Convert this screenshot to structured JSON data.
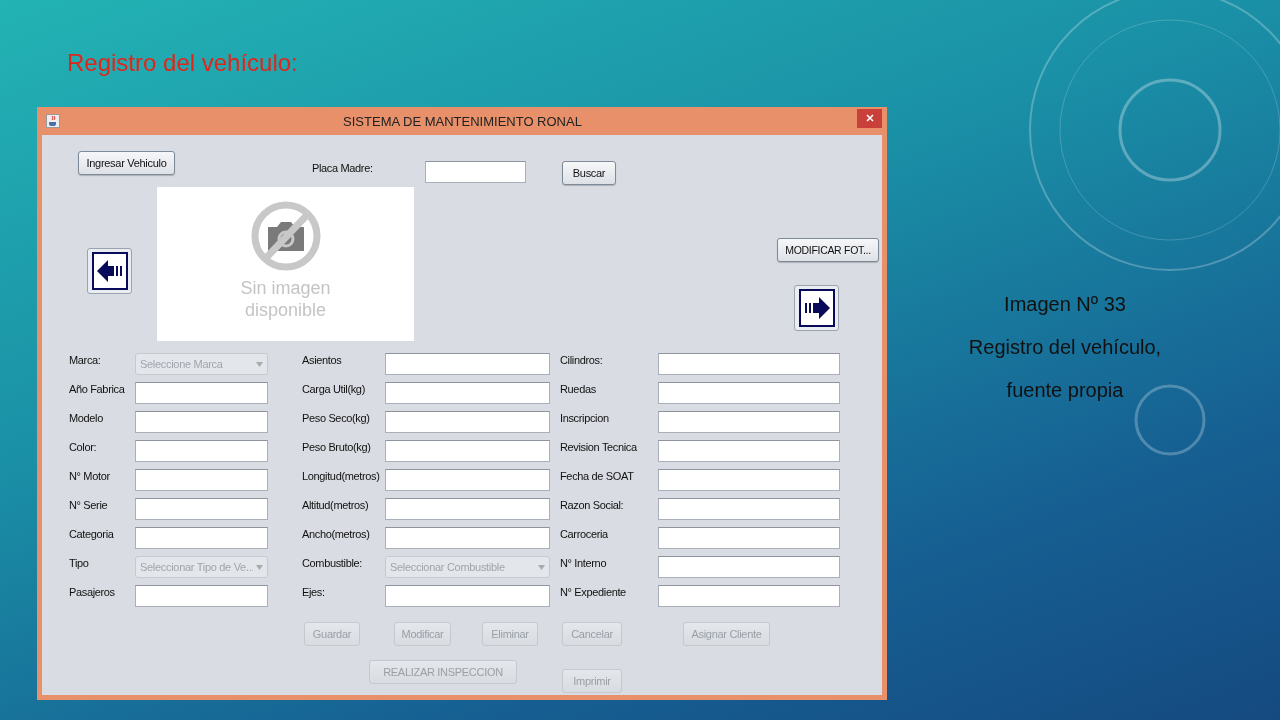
{
  "slide_title": "Registro del vehículo:",
  "window": {
    "title": "SISTEMA DE MANTENIMIENTO RONAL",
    "top": {
      "enter_button": {
        "label": "Ingresar Vehiculo",
        "disabled": false
      },
      "plate_label": "Placa Madre:",
      "search_button": {
        "label": "Buscar",
        "disabled": false
      },
      "photo_text": [
        "Sin imagen",
        "disponible"
      ],
      "photo_button": {
        "label": "MODIFICAR FOT...",
        "disabled": false
      }
    },
    "form_rows": [
      [
        {
          "label": "Marca:",
          "kind": "select",
          "value": "Seleccione Marca",
          "disabled": true
        },
        {
          "label": "Asientos",
          "kind": "text"
        },
        {
          "label": "Cilindros:",
          "kind": "text"
        }
      ],
      [
        {
          "label": "Año Fabrica",
          "kind": "text"
        },
        {
          "label": "Carga Util(kg)",
          "kind": "text"
        },
        {
          "label": "Ruedas",
          "kind": "text"
        }
      ],
      [
        {
          "label": "Modelo",
          "kind": "text"
        },
        {
          "label": "Peso Seco(kg)",
          "kind": "text"
        },
        {
          "label": "Inscripcion",
          "kind": "text"
        }
      ],
      [
        {
          "label": "Color:",
          "kind": "text"
        },
        {
          "label": "Peso Bruto(kg)",
          "kind": "text"
        },
        {
          "label": "Revision Tecnica",
          "kind": "text"
        }
      ],
      [
        {
          "label": "N° Motor",
          "kind": "text"
        },
        {
          "label": "Longitud(metros)",
          "kind": "text"
        },
        {
          "label": "Fecha de SOAT",
          "kind": "text"
        }
      ],
      [
        {
          "label": "N° Serie",
          "kind": "text"
        },
        {
          "label": "Altitud(metros)",
          "kind": "text"
        },
        {
          "label": "Razon Social:",
          "kind": "text"
        }
      ],
      [
        {
          "label": "Categoria",
          "kind": "text"
        },
        {
          "label": "Ancho(metros)",
          "kind": "text"
        },
        {
          "label": "Carroceria",
          "kind": "text"
        }
      ],
      [
        {
          "label": "Tipo",
          "kind": "select",
          "value": "Seleccionar Tipo de Ve...",
          "disabled": true
        },
        {
          "label": "Combustible:",
          "kind": "select",
          "value": "Seleccionar Combustible",
          "disabled": true
        },
        {
          "label": "N° Interno",
          "kind": "text"
        }
      ],
      [
        {
          "label": "Pasajeros",
          "kind": "text"
        },
        {
          "label": "Ejes:",
          "kind": "text"
        },
        {
          "label": "N° Expediente",
          "kind": "text"
        }
      ]
    ],
    "action_buttons": [
      {
        "label": "Guardar",
        "disabled": true
      },
      {
        "label": "Modificar",
        "disabled": true
      },
      {
        "label": "Eliminar",
        "disabled": true
      },
      {
        "label": "Cancelar",
        "disabled": true
      },
      {
        "label": "Asignar Cliente",
        "disabled": true
      }
    ],
    "lower_buttons": [
      {
        "label": "REALIZAR INSPECCION",
        "disabled": true
      },
      {
        "label": "Imprimir",
        "disabled": true
      }
    ]
  },
  "caption": [
    "Imagen Nº 33",
    "Registro del vehículo,",
    "fuente propia"
  ]
}
